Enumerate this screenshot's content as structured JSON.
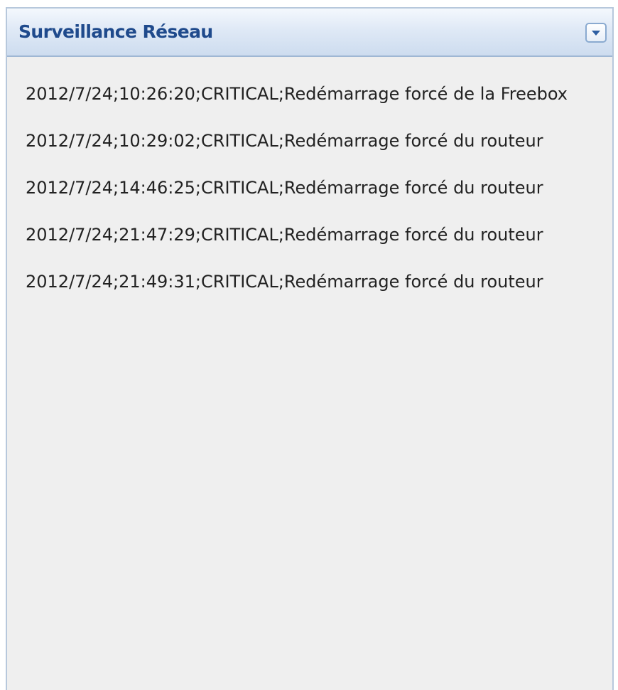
{
  "panel": {
    "title": "Surveillance Réseau",
    "collapse_icon": "chevron-down-icon",
    "colors": {
      "title": "#1f4a8c",
      "header_border": "#9fb7d4",
      "body_background": "#efefef",
      "text": "#222222"
    }
  },
  "log": {
    "entries": [
      {
        "text": "2012/7/24;10:26:20;CRITICAL;Redémarrage forcé de la Freebox"
      },
      {
        "text": "2012/7/24;10:29:02;CRITICAL;Redémarrage forcé du routeur"
      },
      {
        "text": "2012/7/24;14:46:25;CRITICAL;Redémarrage forcé du routeur"
      },
      {
        "text": "2012/7/24;21:47:29;CRITICAL;Redémarrage forcé du routeur"
      },
      {
        "text": "2012/7/24;21:49:31;CRITICAL;Redémarrage forcé du routeur"
      }
    ]
  }
}
